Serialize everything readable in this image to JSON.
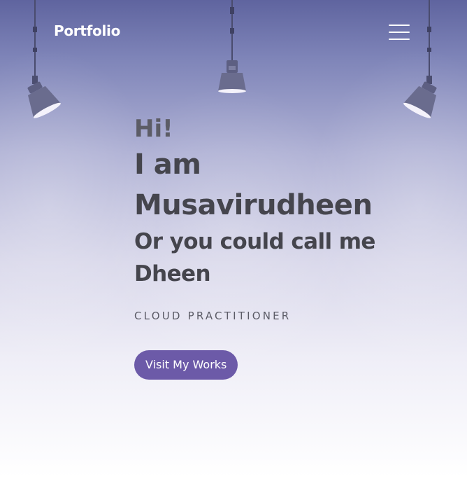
{
  "nav": {
    "logo": "Portfolio",
    "menu_icon": "hamburger-menu-icon"
  },
  "hero": {
    "greeting": "Hi!",
    "intro": "I am\nMusavirudheen",
    "alias": "Or you could call me\nDheen",
    "role": "CLOUD PRACTITIONER",
    "cta_label": "Visit My Works"
  },
  "colors": {
    "accent": "#6c5aa8",
    "heading": "#45454d",
    "background_top": "#5f649f",
    "background_bottom": "#ffffff"
  },
  "decor": {
    "lamps": [
      "left-spotlight-icon",
      "center-spotlight-icon",
      "right-spotlight-icon"
    ]
  }
}
